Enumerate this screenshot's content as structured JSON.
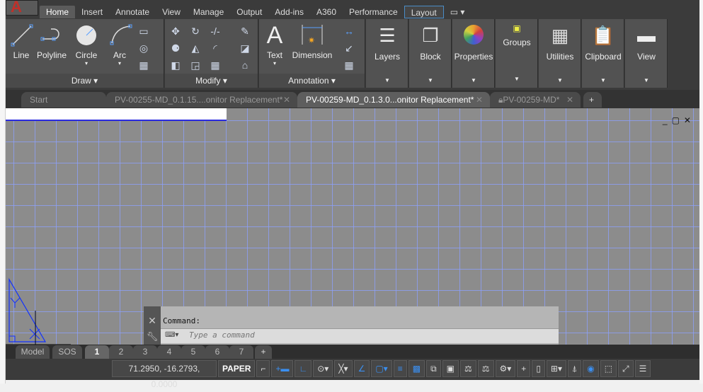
{
  "ribbon_tabs": [
    "Home",
    "Insert",
    "Annotate",
    "View",
    "Manage",
    "Output",
    "Add-ins",
    "A360",
    "Performance",
    "Layout"
  ],
  "draw_panel": {
    "title": "Draw",
    "tools": [
      "Line",
      "Polyline",
      "Circle",
      "Arc"
    ]
  },
  "modify_panel": {
    "title": "Modify"
  },
  "annotation_panel": {
    "title": "Annotation",
    "tools": [
      "Text",
      "Dimension"
    ]
  },
  "panels": [
    "Layers",
    "Block",
    "Properties",
    "Groups",
    "Utilities",
    "Clipboard",
    "View"
  ],
  "doc_tabs": [
    "Start",
    "PV-00255-MD_0.1.15....onitor Replacement*",
    "PV-00259-MD_0.1.3.0...onitor Replacement*",
    "PV-00259-MD*"
  ],
  "command": {
    "label": "Command:",
    "placeholder": "Type a command"
  },
  "layout_tabs": [
    "Model",
    "SOS",
    "1",
    "2",
    "3",
    "4",
    "5",
    "6",
    "7"
  ],
  "status": {
    "coords": "71.2950, -16.2793, 0.0000",
    "space": "PAPER"
  },
  "colors": {
    "accent": "#3b8ff0",
    "grid": "#8ca0ff"
  }
}
